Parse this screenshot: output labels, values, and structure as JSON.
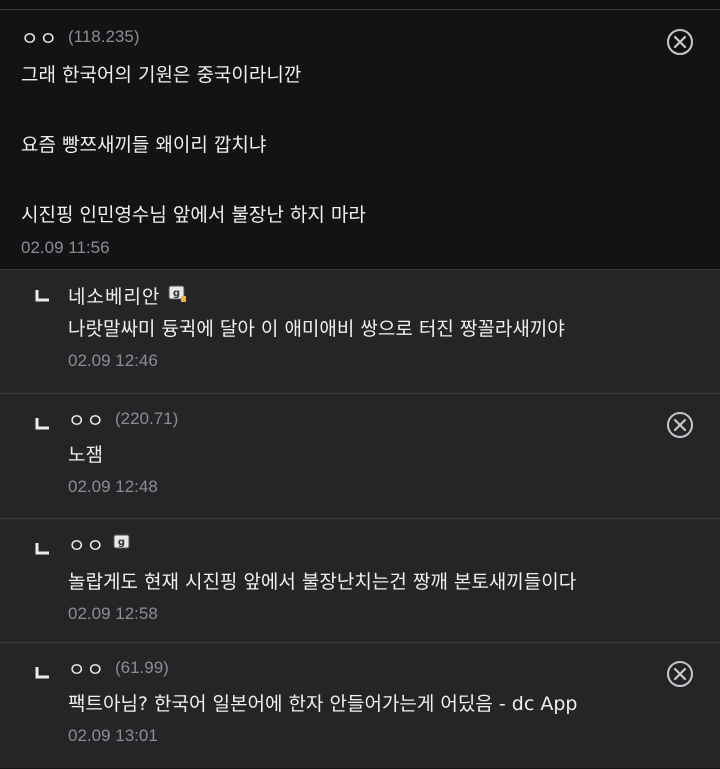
{
  "comment": {
    "nick": "ㅇㅇ",
    "ip": "(118.235)",
    "lines": [
      "그래 한국어의 기원은 중국이라니깐",
      "",
      "요즘 빵쯔새끼들 왜이리 깝치냐",
      "",
      "시진핑 인민영수님 앞에서 불장난 하지 마라"
    ],
    "date": "02.09 11:56",
    "delete_icon": "close-circle-icon"
  },
  "replies": [
    {
      "nick": "네소베리안",
      "badge_icon": "gallog-badge-icon",
      "text": "나랏말싸미 듕귁에 달아 이 애미애비 쌍으로 터진 짱꼴라새끼야",
      "date": "02.09 12:46"
    },
    {
      "nick": "ㅇㅇ",
      "ip": "(220.71)",
      "text": "노잼",
      "date": "02.09 12:48",
      "delete_icon": "close-circle-icon"
    },
    {
      "nick": "ㅇㅇ",
      "badge_icon": "gallog-badge-icon",
      "text": "놀랍게도 현재 시진핑 앞에서 불장난치는건 짱깨 본토새끼들이다",
      "date": "02.09 12:58"
    },
    {
      "nick": "ㅇㅇ",
      "ip": "(61.99)",
      "text": "팩트아님? 한국어 일본어에 한자 안들어가는게 어딨음 - dc App",
      "date": "02.09 13:01",
      "delete_icon": "close-circle-icon"
    }
  ],
  "colors": {
    "background": "#131315",
    "reply_background": "#252528",
    "divider": "#3b3b40",
    "muted_text": "#8c8c92",
    "text": "#ececee"
  }
}
